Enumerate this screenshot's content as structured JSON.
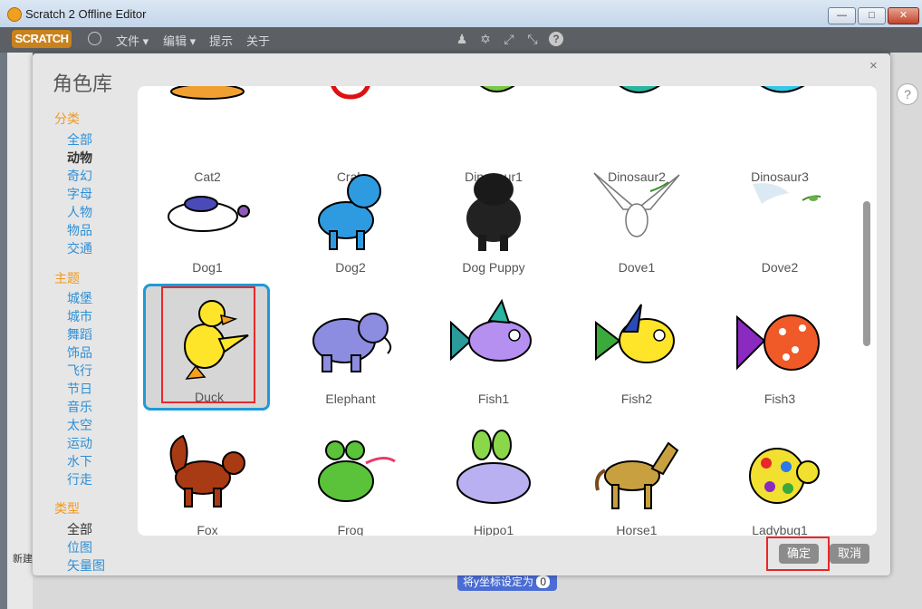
{
  "window": {
    "title": "Scratch 2 Offline Editor"
  },
  "menubar": {
    "logo": "SCRATCH",
    "items": [
      "文件",
      "编辑",
      "提示",
      "关于"
    ]
  },
  "dialog": {
    "title": "角色库",
    "close": "×",
    "categories": {
      "heading": "分类",
      "items": [
        "全部",
        "动物",
        "奇幻",
        "字母",
        "人物",
        "物品",
        "交通"
      ]
    },
    "themes": {
      "heading": "主题",
      "items": [
        "城堡",
        "城市",
        "舞蹈",
        "饰品",
        "飞行",
        "节日",
        "音乐",
        "太空",
        "运动",
        "水下",
        "行走"
      ]
    },
    "types": {
      "heading": "类型",
      "items": [
        "全部",
        "位图",
        "矢量图"
      ]
    },
    "sprites": [
      "Cat2",
      "Crab",
      "Dinosaur1",
      "Dinosaur2",
      "Dinosaur3",
      "Dog1",
      "Dog2",
      "Dog Puppy",
      "Dove1",
      "Dove2",
      "Duck",
      "Elephant",
      "Fish1",
      "Fish2",
      "Fish3",
      "Fox",
      "Frog",
      "Hippo1",
      "Horse1",
      "Ladybug1"
    ],
    "selected_sprite": "Duck",
    "ok_label": "确定",
    "cancel_label": "取消"
  },
  "background": {
    "block_label": "将y坐标设定为",
    "block_value": "0",
    "new_sprite_label": "新建",
    "help": "?"
  }
}
